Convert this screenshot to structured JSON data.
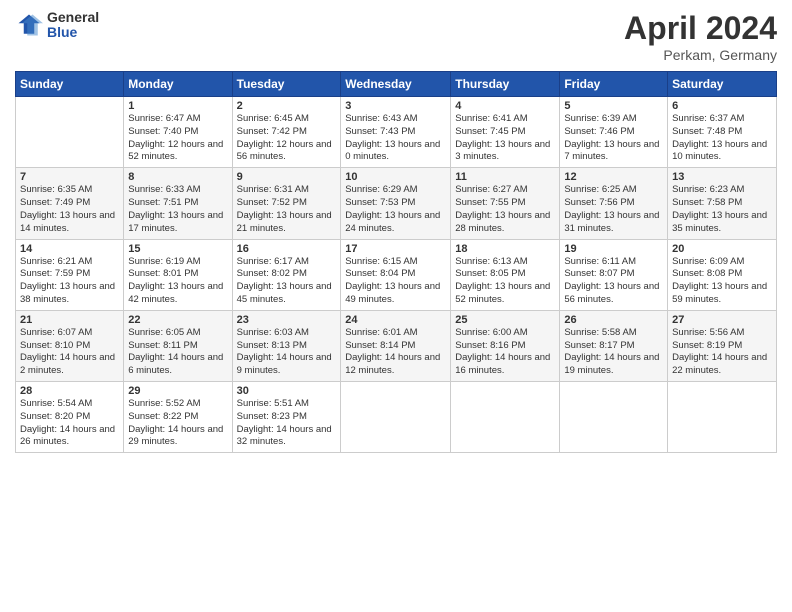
{
  "header": {
    "logo_general": "General",
    "logo_blue": "Blue",
    "title": "April 2024",
    "location": "Perkam, Germany"
  },
  "days_of_week": [
    "Sunday",
    "Monday",
    "Tuesday",
    "Wednesday",
    "Thursday",
    "Friday",
    "Saturday"
  ],
  "weeks": [
    [
      {
        "day": "",
        "sunrise": "",
        "sunset": "",
        "daylight": ""
      },
      {
        "day": "1",
        "sunrise": "Sunrise: 6:47 AM",
        "sunset": "Sunset: 7:40 PM",
        "daylight": "Daylight: 12 hours and 52 minutes."
      },
      {
        "day": "2",
        "sunrise": "Sunrise: 6:45 AM",
        "sunset": "Sunset: 7:42 PM",
        "daylight": "Daylight: 12 hours and 56 minutes."
      },
      {
        "day": "3",
        "sunrise": "Sunrise: 6:43 AM",
        "sunset": "Sunset: 7:43 PM",
        "daylight": "Daylight: 13 hours and 0 minutes."
      },
      {
        "day": "4",
        "sunrise": "Sunrise: 6:41 AM",
        "sunset": "Sunset: 7:45 PM",
        "daylight": "Daylight: 13 hours and 3 minutes."
      },
      {
        "day": "5",
        "sunrise": "Sunrise: 6:39 AM",
        "sunset": "Sunset: 7:46 PM",
        "daylight": "Daylight: 13 hours and 7 minutes."
      },
      {
        "day": "6",
        "sunrise": "Sunrise: 6:37 AM",
        "sunset": "Sunset: 7:48 PM",
        "daylight": "Daylight: 13 hours and 10 minutes."
      }
    ],
    [
      {
        "day": "7",
        "sunrise": "Sunrise: 6:35 AM",
        "sunset": "Sunset: 7:49 PM",
        "daylight": "Daylight: 13 hours and 14 minutes."
      },
      {
        "day": "8",
        "sunrise": "Sunrise: 6:33 AM",
        "sunset": "Sunset: 7:51 PM",
        "daylight": "Daylight: 13 hours and 17 minutes."
      },
      {
        "day": "9",
        "sunrise": "Sunrise: 6:31 AM",
        "sunset": "Sunset: 7:52 PM",
        "daylight": "Daylight: 13 hours and 21 minutes."
      },
      {
        "day": "10",
        "sunrise": "Sunrise: 6:29 AM",
        "sunset": "Sunset: 7:53 PM",
        "daylight": "Daylight: 13 hours and 24 minutes."
      },
      {
        "day": "11",
        "sunrise": "Sunrise: 6:27 AM",
        "sunset": "Sunset: 7:55 PM",
        "daylight": "Daylight: 13 hours and 28 minutes."
      },
      {
        "day": "12",
        "sunrise": "Sunrise: 6:25 AM",
        "sunset": "Sunset: 7:56 PM",
        "daylight": "Daylight: 13 hours and 31 minutes."
      },
      {
        "day": "13",
        "sunrise": "Sunrise: 6:23 AM",
        "sunset": "Sunset: 7:58 PM",
        "daylight": "Daylight: 13 hours and 35 minutes."
      }
    ],
    [
      {
        "day": "14",
        "sunrise": "Sunrise: 6:21 AM",
        "sunset": "Sunset: 7:59 PM",
        "daylight": "Daylight: 13 hours and 38 minutes."
      },
      {
        "day": "15",
        "sunrise": "Sunrise: 6:19 AM",
        "sunset": "Sunset: 8:01 PM",
        "daylight": "Daylight: 13 hours and 42 minutes."
      },
      {
        "day": "16",
        "sunrise": "Sunrise: 6:17 AM",
        "sunset": "Sunset: 8:02 PM",
        "daylight": "Daylight: 13 hours and 45 minutes."
      },
      {
        "day": "17",
        "sunrise": "Sunrise: 6:15 AM",
        "sunset": "Sunset: 8:04 PM",
        "daylight": "Daylight: 13 hours and 49 minutes."
      },
      {
        "day": "18",
        "sunrise": "Sunrise: 6:13 AM",
        "sunset": "Sunset: 8:05 PM",
        "daylight": "Daylight: 13 hours and 52 minutes."
      },
      {
        "day": "19",
        "sunrise": "Sunrise: 6:11 AM",
        "sunset": "Sunset: 8:07 PM",
        "daylight": "Daylight: 13 hours and 56 minutes."
      },
      {
        "day": "20",
        "sunrise": "Sunrise: 6:09 AM",
        "sunset": "Sunset: 8:08 PM",
        "daylight": "Daylight: 13 hours and 59 minutes."
      }
    ],
    [
      {
        "day": "21",
        "sunrise": "Sunrise: 6:07 AM",
        "sunset": "Sunset: 8:10 PM",
        "daylight": "Daylight: 14 hours and 2 minutes."
      },
      {
        "day": "22",
        "sunrise": "Sunrise: 6:05 AM",
        "sunset": "Sunset: 8:11 PM",
        "daylight": "Daylight: 14 hours and 6 minutes."
      },
      {
        "day": "23",
        "sunrise": "Sunrise: 6:03 AM",
        "sunset": "Sunset: 8:13 PM",
        "daylight": "Daylight: 14 hours and 9 minutes."
      },
      {
        "day": "24",
        "sunrise": "Sunrise: 6:01 AM",
        "sunset": "Sunset: 8:14 PM",
        "daylight": "Daylight: 14 hours and 12 minutes."
      },
      {
        "day": "25",
        "sunrise": "Sunrise: 6:00 AM",
        "sunset": "Sunset: 8:16 PM",
        "daylight": "Daylight: 14 hours and 16 minutes."
      },
      {
        "day": "26",
        "sunrise": "Sunrise: 5:58 AM",
        "sunset": "Sunset: 8:17 PM",
        "daylight": "Daylight: 14 hours and 19 minutes."
      },
      {
        "day": "27",
        "sunrise": "Sunrise: 5:56 AM",
        "sunset": "Sunset: 8:19 PM",
        "daylight": "Daylight: 14 hours and 22 minutes."
      }
    ],
    [
      {
        "day": "28",
        "sunrise": "Sunrise: 5:54 AM",
        "sunset": "Sunset: 8:20 PM",
        "daylight": "Daylight: 14 hours and 26 minutes."
      },
      {
        "day": "29",
        "sunrise": "Sunrise: 5:52 AM",
        "sunset": "Sunset: 8:22 PM",
        "daylight": "Daylight: 14 hours and 29 minutes."
      },
      {
        "day": "30",
        "sunrise": "Sunrise: 5:51 AM",
        "sunset": "Sunset: 8:23 PM",
        "daylight": "Daylight: 14 hours and 32 minutes."
      },
      {
        "day": "",
        "sunrise": "",
        "sunset": "",
        "daylight": ""
      },
      {
        "day": "",
        "sunrise": "",
        "sunset": "",
        "daylight": ""
      },
      {
        "day": "",
        "sunrise": "",
        "sunset": "",
        "daylight": ""
      },
      {
        "day": "",
        "sunrise": "",
        "sunset": "",
        "daylight": ""
      }
    ]
  ]
}
